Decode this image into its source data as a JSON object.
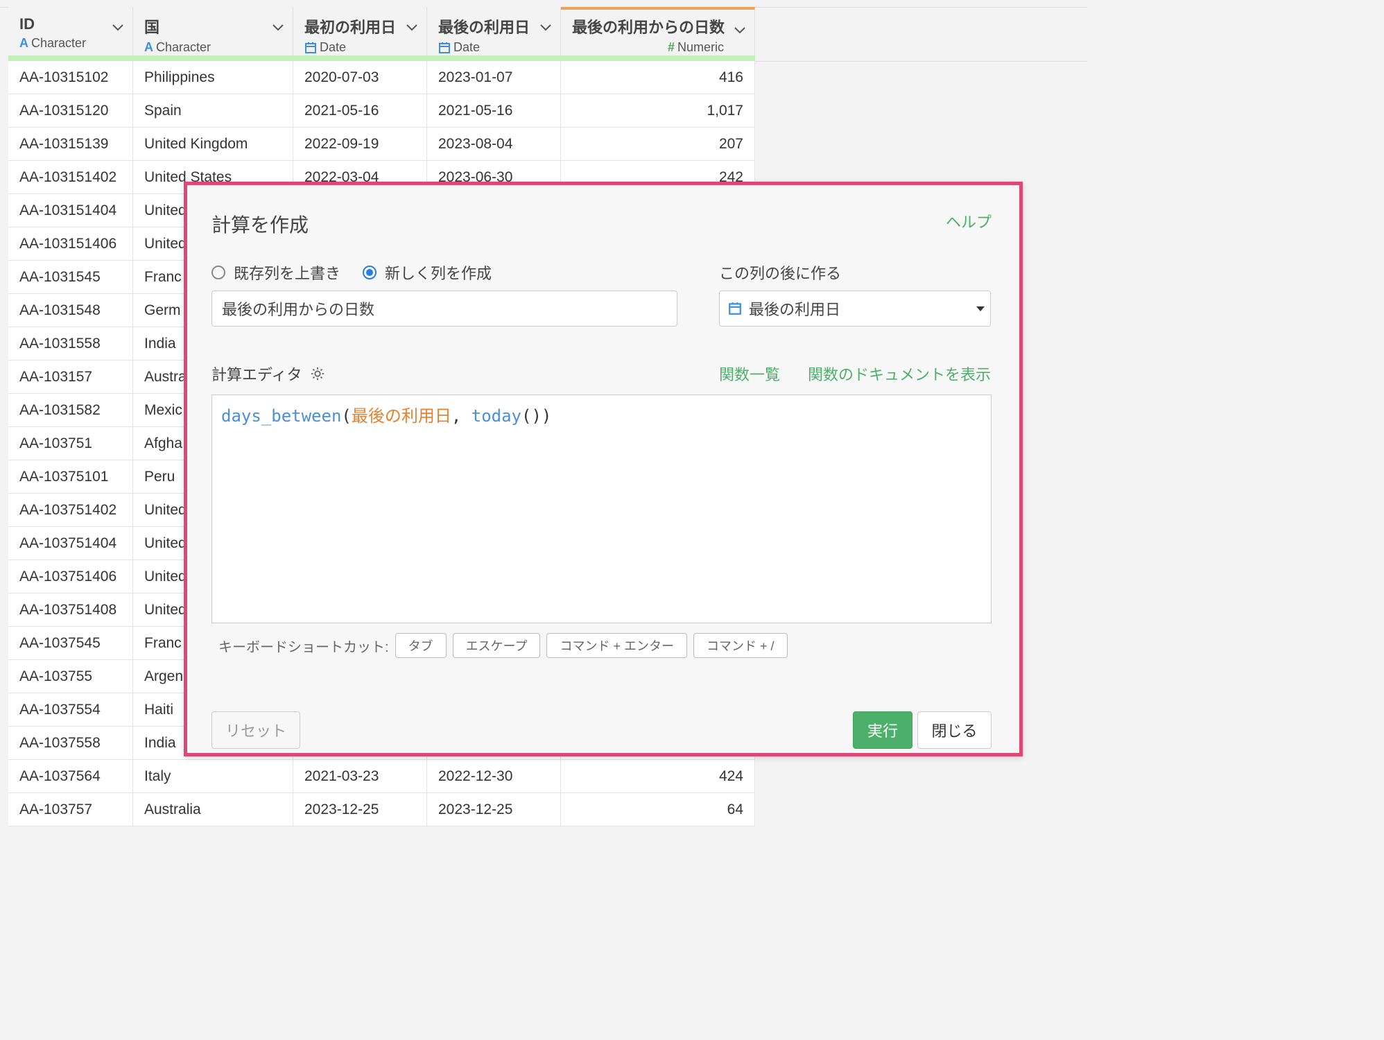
{
  "columns": [
    {
      "title": "ID",
      "type_icon": "A",
      "type": "Character"
    },
    {
      "title": "国",
      "type_icon": "A",
      "type": "Character"
    },
    {
      "title": "最初の利用日",
      "type_icon": "calendar-icon",
      "type": "Date"
    },
    {
      "title": "最後の利用日",
      "type_icon": "calendar-icon",
      "type": "Date"
    },
    {
      "title": "最後の利用からの日数",
      "type_icon": "#",
      "type": "Numeric"
    }
  ],
  "rows": [
    [
      "AA-10315102",
      "Philippines",
      "2020-07-03",
      "2023-01-07",
      "416"
    ],
    [
      "AA-10315120",
      "Spain",
      "2021-05-16",
      "2021-05-16",
      "1,017"
    ],
    [
      "AA-10315139",
      "United Kingdom",
      "2022-09-19",
      "2023-08-04",
      "207"
    ],
    [
      "AA-103151402",
      "United States",
      "2022-03-04",
      "2023-06-30",
      "242"
    ],
    [
      "AA-103151404",
      "United",
      "",
      "",
      ""
    ],
    [
      "AA-103151406",
      "United",
      "",
      "",
      ""
    ],
    [
      "AA-1031545",
      "Franc",
      "",
      "",
      ""
    ],
    [
      "AA-1031548",
      "Germ",
      "",
      "",
      ""
    ],
    [
      "AA-1031558",
      "India",
      "",
      "",
      ""
    ],
    [
      "AA-103157",
      "Austra",
      "",
      "",
      ""
    ],
    [
      "AA-1031582",
      "Mexic",
      "",
      "",
      ""
    ],
    [
      "AA-103751",
      "Afgha",
      "",
      "",
      ""
    ],
    [
      "AA-10375101",
      "Peru",
      "",
      "",
      ""
    ],
    [
      "AA-103751402",
      "United",
      "",
      "",
      ""
    ],
    [
      "AA-103751404",
      "United",
      "",
      "",
      ""
    ],
    [
      "AA-103751406",
      "United",
      "",
      "",
      ""
    ],
    [
      "AA-103751408",
      "United",
      "",
      "",
      ""
    ],
    [
      "AA-1037545",
      "Franc",
      "",
      "",
      ""
    ],
    [
      "AA-103755",
      "Argen",
      "",
      "",
      ""
    ],
    [
      "AA-1037554",
      "Haiti",
      "",
      "",
      ""
    ],
    [
      "AA-1037558",
      "India",
      "",
      "",
      ""
    ],
    [
      "AA-1037564",
      "Italy",
      "2021-03-23",
      "2022-12-30",
      "424"
    ],
    [
      "AA-103757",
      "Australia",
      "2023-12-25",
      "2023-12-25",
      "64"
    ]
  ],
  "dialog": {
    "title": "計算を作成",
    "help": "ヘルプ",
    "radio_overwrite": "既存列を上書き",
    "radio_new": "新しく列を作成",
    "after_label": "この列の後に作る",
    "column_name": "最後の利用からの日数",
    "after_column": "最後の利用日",
    "editor_label": "計算エディタ",
    "function_list": "関数一覧",
    "function_docs": "関数のドキュメントを表示",
    "expression": {
      "fn": "days_between",
      "open": "(",
      "col": "最後の利用日",
      "comma": ", ",
      "fn2": "today",
      "close": "())"
    },
    "shortcuts_label": "キーボードショートカット:",
    "shortcuts": [
      "タブ",
      "エスケープ",
      "コマンド + エンター",
      "コマンド + /"
    ],
    "reset": "リセット",
    "run": "実行",
    "close": "閉じる"
  },
  "colors": {
    "accent_green": "#4caf6a",
    "dialog_border": "#e04874",
    "header_bar": "#c3efb9"
  }
}
